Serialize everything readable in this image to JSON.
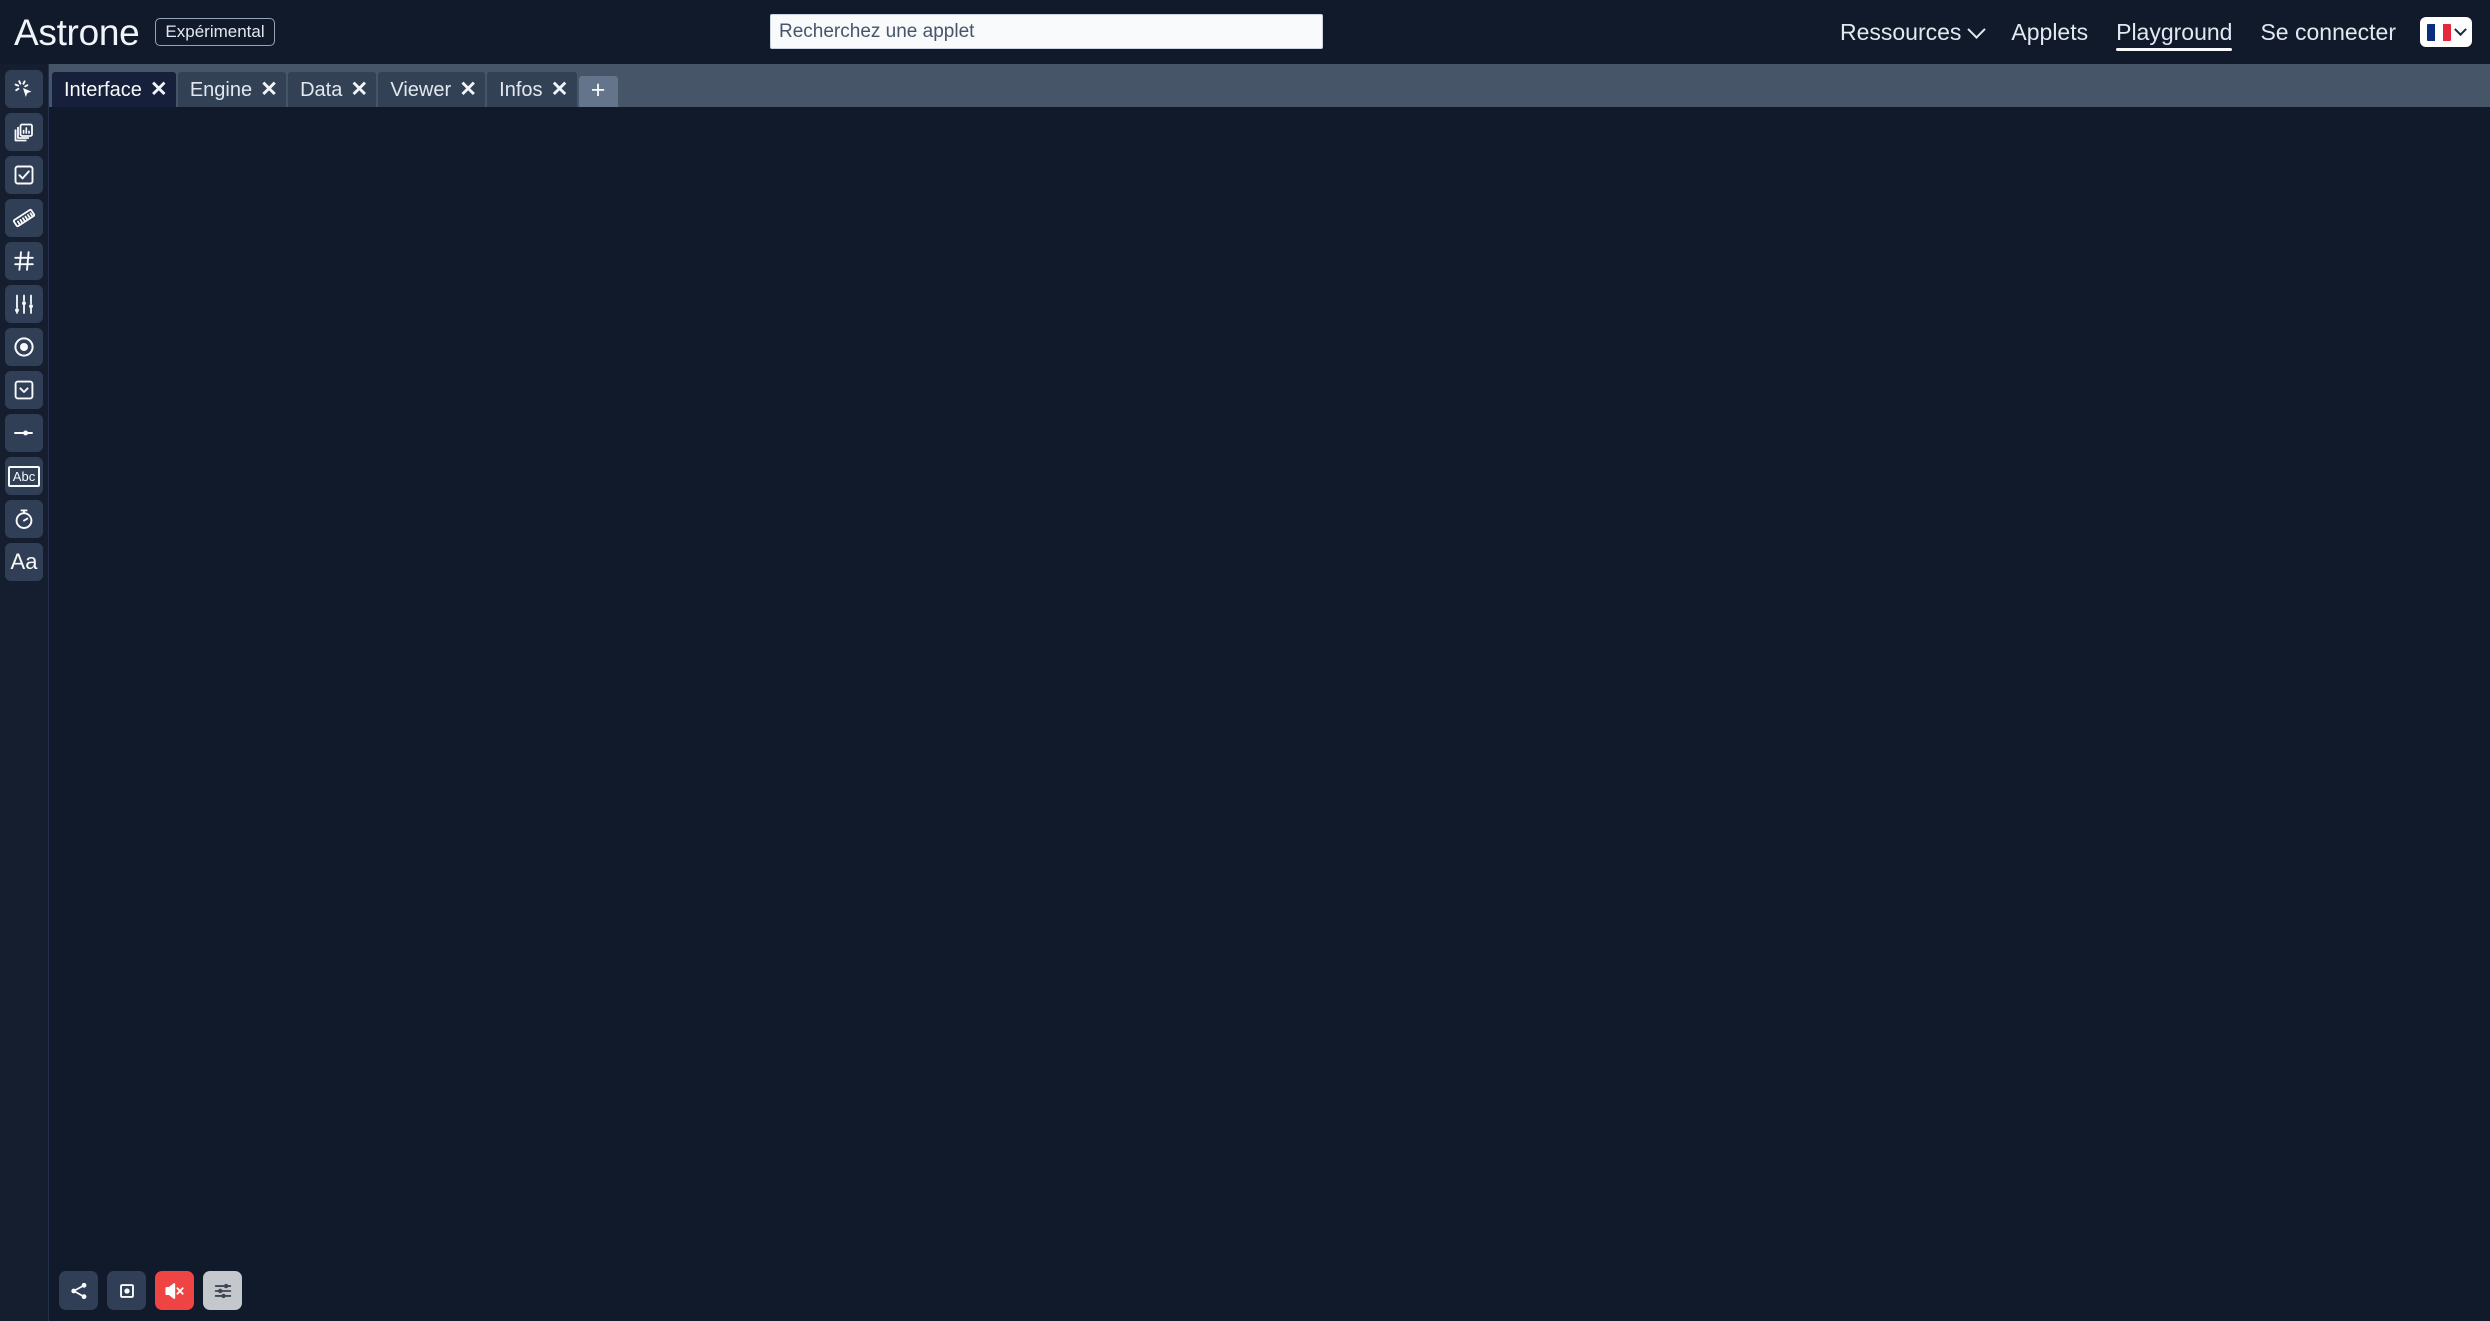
{
  "header": {
    "brand_name": "Astrone",
    "brand_badge": "Expérimental",
    "search": {
      "value": "",
      "placeholder": "Recherchez une applet",
      "icon": "search-input"
    },
    "nav": [
      {
        "label": "Ressources",
        "has_chevron": true,
        "active": false,
        "icon": "chevron-down-icon"
      },
      {
        "label": "Applets",
        "has_chevron": false,
        "active": false
      },
      {
        "label": "Playground",
        "has_chevron": false,
        "active": true
      },
      {
        "label": "Se connecter",
        "has_chevron": false,
        "active": false
      }
    ],
    "language": {
      "flag": "french-flag-icon",
      "chevron": "chevron-down-icon"
    }
  },
  "sidebar": {
    "items": [
      {
        "name": "cursor-click-icon",
        "label": "Bouton"
      },
      {
        "name": "chart-stack-icon",
        "label": "Graphique"
      },
      {
        "name": "checkbox-icon",
        "label": "Case à cocher"
      },
      {
        "name": "ruler-icon",
        "label": "Règle"
      },
      {
        "name": "grid-icon",
        "label": "Grille"
      },
      {
        "name": "sliders-icon",
        "label": "Curseurs"
      },
      {
        "name": "radio-button-icon",
        "label": "Bouton radio"
      },
      {
        "name": "dropdown-icon",
        "label": "Liste déroulante"
      },
      {
        "name": "slider-icon",
        "label": "Curseur"
      },
      {
        "name": "text-input-icon",
        "label": "Abc"
      },
      {
        "name": "stopwatch-icon",
        "label": "Chronomètre"
      },
      {
        "name": "typography-icon",
        "label": "Aa"
      }
    ]
  },
  "tabs": {
    "items": [
      {
        "label": "Interface",
        "active": true,
        "close_icon": "close-icon"
      },
      {
        "label": "Engine",
        "active": false,
        "close_icon": "close-icon"
      },
      {
        "label": "Data",
        "active": false,
        "close_icon": "close-icon"
      },
      {
        "label": "Viewer",
        "active": false,
        "close_icon": "close-icon"
      },
      {
        "label": "Infos",
        "active": false,
        "close_icon": "close-icon"
      }
    ],
    "add_label": "+"
  },
  "bottom_toolbar": {
    "buttons": [
      {
        "name": "share-button",
        "icon": "share-icon",
        "style": "dark"
      },
      {
        "name": "record-button",
        "icon": "stop-square-icon",
        "style": "dark"
      },
      {
        "name": "mute-button",
        "icon": "volume-muted-icon",
        "style": "danger"
      },
      {
        "name": "settings-button",
        "icon": "sliders-icon",
        "style": "light"
      }
    ]
  },
  "colors": {
    "header_bg": "#111A2B",
    "canvas_bg": "#111A2B",
    "sidebar_bg": "#151E2E",
    "tabbar_bg": "#475569",
    "tab_inactive_bg": "#334155",
    "tab_active_bg": "#16203A",
    "tool_bg": "#313F56",
    "accent_danger": "#EF4444",
    "accent_light": "#C4C8CC",
    "text_primary": "#F1F5F9"
  }
}
